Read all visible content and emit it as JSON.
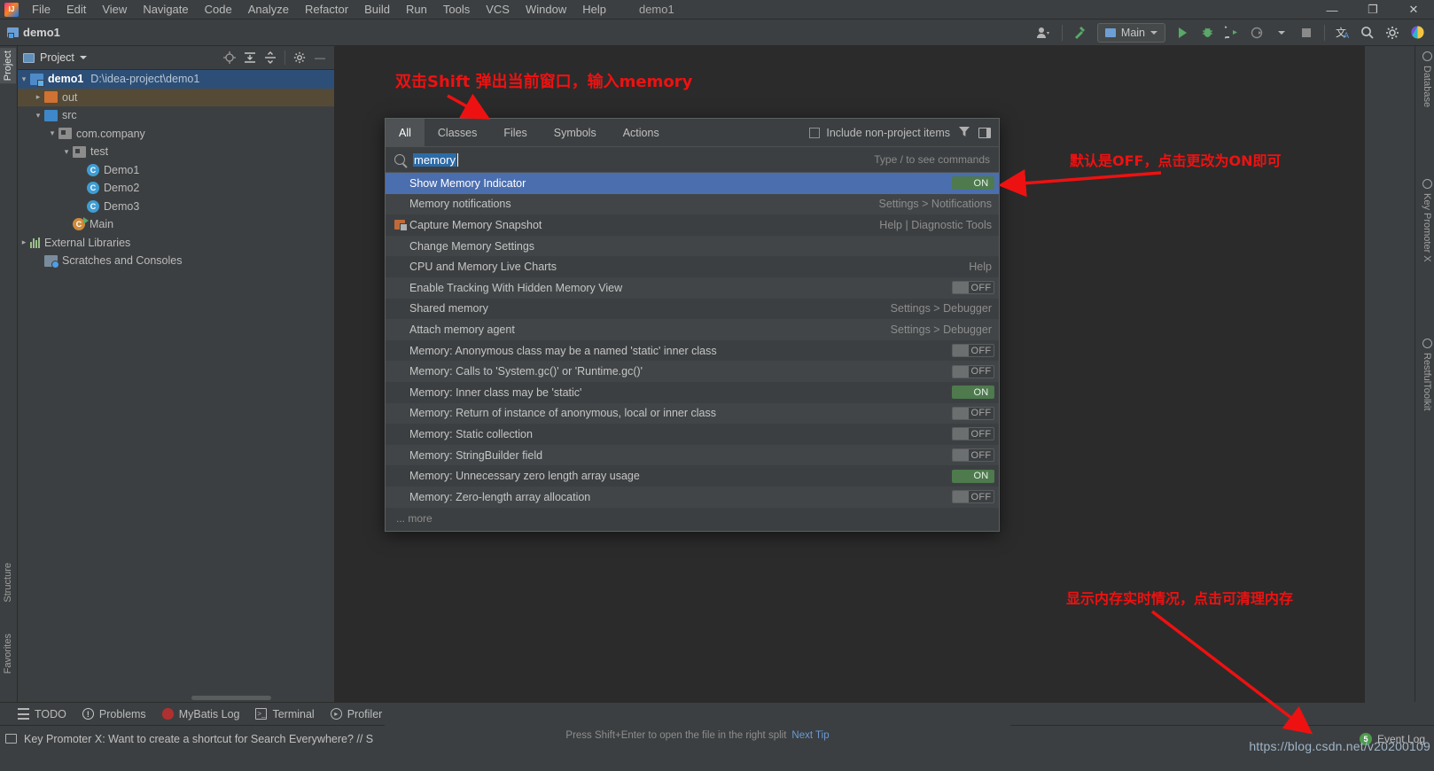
{
  "window": {
    "title": "demo1",
    "menus": [
      "File",
      "Edit",
      "View",
      "Navigate",
      "Code",
      "Analyze",
      "Refactor",
      "Build",
      "Run",
      "Tools",
      "VCS",
      "Window",
      "Help"
    ],
    "controls": {
      "minimize": "—",
      "maximize": "❐",
      "close": "✕"
    }
  },
  "toolbar": {
    "project_label": "demo1",
    "run_config": "Main",
    "icons": [
      "user-avatar-icon",
      "hammer-icon",
      "run-icon",
      "debug-icon",
      "run-coverage-icon",
      "profile-icon",
      "stop-icon",
      "translate-icon",
      "search-icon",
      "settings-icon",
      "plugin-icon"
    ]
  },
  "left_strip": {
    "items": [
      {
        "label": "Project",
        "active": true
      },
      {
        "label": "Structure",
        "active": false
      },
      {
        "label": "Favorites",
        "active": false
      }
    ]
  },
  "right_strip": {
    "items": [
      "Database",
      "Key Promoter X",
      "RestfulToolkit"
    ]
  },
  "project_panel": {
    "title": "Project",
    "tools": [
      "locate-icon",
      "expand-all-icon",
      "collapse-all-icon",
      "gear-icon",
      "hide-icon"
    ],
    "tree": [
      {
        "label": "demo1",
        "path": "D:\\idea-project\\demo1",
        "icon": "project-folder-icon",
        "indent": 0,
        "arrow": "▾",
        "selected": true,
        "bold": true
      },
      {
        "label": "out",
        "path": "",
        "icon": "folder-orange-icon",
        "indent": 1,
        "arrow": "▸",
        "highlight": true
      },
      {
        "label": "src",
        "path": "",
        "icon": "folder-blue-icon",
        "indent": 1,
        "arrow": "▾"
      },
      {
        "label": "com.company",
        "path": "",
        "icon": "package-icon",
        "indent": 2,
        "arrow": "▾"
      },
      {
        "label": "test",
        "path": "",
        "icon": "package-icon",
        "indent": 3,
        "arrow": "▾"
      },
      {
        "label": "Demo1",
        "path": "",
        "icon": "class-icon",
        "indent": 4,
        "arrow": ""
      },
      {
        "label": "Demo2",
        "path": "",
        "icon": "class-icon",
        "indent": 4,
        "arrow": ""
      },
      {
        "label": "Demo3",
        "path": "",
        "icon": "class-icon",
        "indent": 4,
        "arrow": ""
      },
      {
        "label": "Main",
        "path": "",
        "icon": "runnable-class-icon",
        "indent": 3,
        "arrow": ""
      },
      {
        "label": "External Libraries",
        "path": "",
        "icon": "library-icon",
        "indent": 0,
        "arrow": "▸"
      },
      {
        "label": "Scratches and Consoles",
        "path": "",
        "icon": "scratch-icon",
        "indent": 1,
        "arrow": ""
      }
    ]
  },
  "search_everywhere": {
    "tabs": [
      "All",
      "Classes",
      "Files",
      "Symbols",
      "Actions"
    ],
    "active_tab": "All",
    "include_non_project": "Include non-project items",
    "include_non_project_checked": false,
    "query": "memory",
    "query_placeholder": "Type / to see commands",
    "hint": "Type / to see commands",
    "more_label": "... more",
    "footer_text": "Press Shift+Enter to open the file in the right split",
    "footer_link": "Next Tip",
    "results": [
      {
        "label": "Show Memory Indicator",
        "meta": "",
        "toggle": "ON",
        "selected": true,
        "icon": ""
      },
      {
        "label": "Memory notifications",
        "meta": "Settings > Notifications",
        "toggle": "",
        "icon": ""
      },
      {
        "label": "Capture Memory Snapshot",
        "meta": "Help | Diagnostic Tools",
        "toggle": "",
        "icon": "snapshot-icon"
      },
      {
        "label": "Change Memory Settings",
        "meta": "",
        "toggle": "",
        "icon": ""
      },
      {
        "label": "CPU and Memory Live Charts",
        "meta": "Help",
        "toggle": "",
        "icon": ""
      },
      {
        "label": "Enable Tracking With Hidden Memory View",
        "meta": "",
        "toggle": "OFF",
        "icon": ""
      },
      {
        "label": "Shared memory",
        "meta": "Settings > Debugger",
        "toggle": "",
        "icon": ""
      },
      {
        "label": "Attach memory agent",
        "meta": "Settings > Debugger",
        "toggle": "",
        "icon": ""
      },
      {
        "label": "Memory: Anonymous class may be a named 'static' inner class",
        "meta": "",
        "toggle": "OFF",
        "icon": ""
      },
      {
        "label": "Memory: Calls to 'System.gc()' or 'Runtime.gc()'",
        "meta": "",
        "toggle": "OFF",
        "icon": ""
      },
      {
        "label": "Memory: Inner class may be 'static'",
        "meta": "",
        "toggle": "ON",
        "icon": ""
      },
      {
        "label": "Memory: Return of instance of anonymous, local or inner class",
        "meta": "",
        "toggle": "OFF",
        "icon": ""
      },
      {
        "label": "Memory: Static collection",
        "meta": "",
        "toggle": "OFF",
        "icon": ""
      },
      {
        "label": "Memory: StringBuilder field",
        "meta": "",
        "toggle": "OFF",
        "icon": ""
      },
      {
        "label": "Memory: Unnecessary zero length array usage",
        "meta": "",
        "toggle": "ON",
        "icon": ""
      },
      {
        "label": "Memory: Zero-length array allocation",
        "meta": "",
        "toggle": "OFF",
        "icon": ""
      }
    ]
  },
  "bottom_bar": {
    "items": [
      {
        "label": "TODO",
        "icon": "todo-icon"
      },
      {
        "label": "Problems",
        "icon": "problems-icon"
      },
      {
        "label": "MyBatis Log",
        "icon": "mybatis-icon"
      },
      {
        "label": "Terminal",
        "icon": "terminal-icon"
      },
      {
        "label": "Profiler",
        "icon": "profiler-icon"
      }
    ]
  },
  "status_bar": {
    "message": "Key Promoter X: Want to create a shortcut for Search Everywhere? // S",
    "event_log": "Event Log",
    "event_badge": "5"
  },
  "annotations": {
    "top": "双击Shift 弹出当前窗口，输入memory",
    "right": "默认是OFF，点击更改为ON即可",
    "bottom": "显示内存实时情况，点击可清理内存",
    "watermark": "https://blog.csdn.net/v20200109"
  },
  "colors": {
    "accent_blue": "#4b6eaf",
    "toggle_on": "#4e7a4e",
    "annotation_red": "#ee1111",
    "panel_bg": "#3c3f41",
    "editor_bg": "#2b2b2b"
  }
}
